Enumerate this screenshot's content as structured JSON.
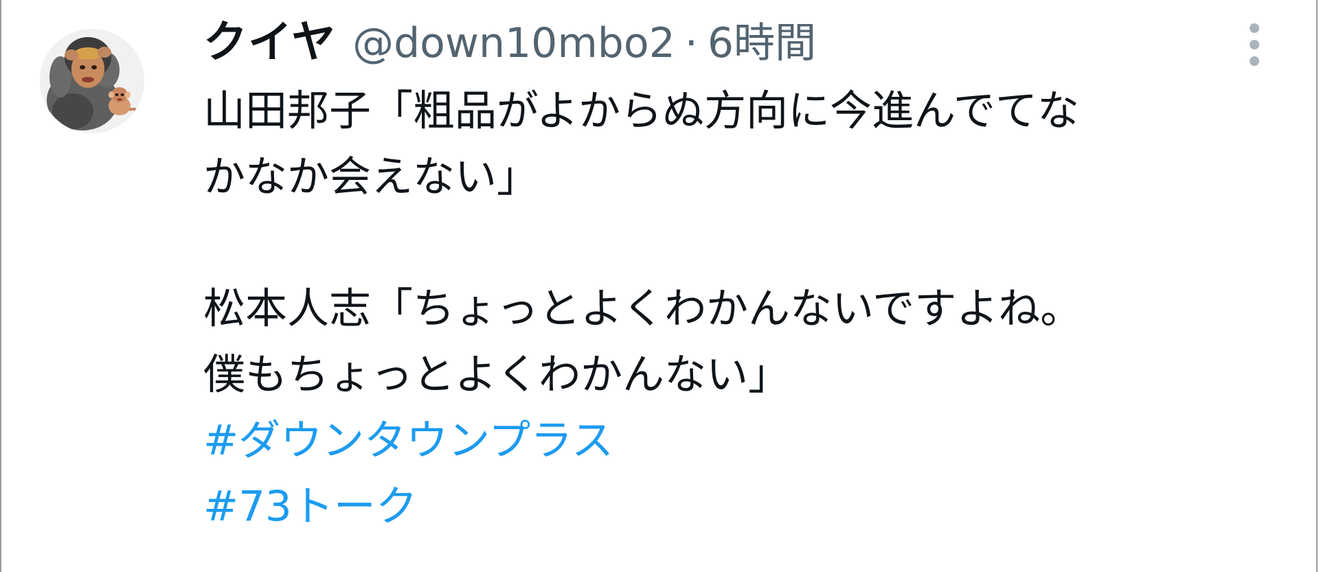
{
  "tweet": {
    "display_name": "クイヤ",
    "handle": "@down10mbo2",
    "separator": "·",
    "time": "6時間",
    "body_lines": [
      "山田邦子「粗品がよからぬ方向に今進んでてな",
      "かなか会えない」",
      "",
      "松本人志「ちょっとよくわかんないですよね。",
      "僕もちょっとよくわかんない」"
    ],
    "hashtags": [
      "#ダウンタウンプラス",
      "#73トーク"
    ]
  },
  "icons": {
    "more": "more-vertical-icon",
    "avatar": "user-avatar"
  },
  "colors": {
    "text": "#0f1419",
    "secondary": "#536471",
    "link": "#1d9bf0",
    "more_dots": "#a9b4bd",
    "frame_border": "#9a9a9a"
  }
}
